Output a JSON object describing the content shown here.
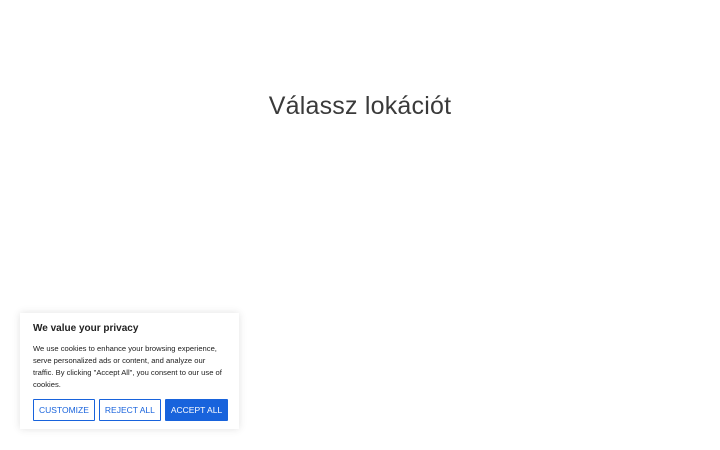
{
  "page": {
    "title": "Válassz lokációt"
  },
  "cookie_banner": {
    "title": "We value your privacy",
    "text": "We use cookies to enhance your browsing experience, serve personalized ads or content, and analyze our traffic. By clicking \"Accept All\", you consent to our use of cookies.",
    "customize_label": "CUSTOMIZE",
    "reject_label": "REJECT ALL",
    "accept_label": "ACCEPT ALL",
    "accent_color": "#1863dc"
  }
}
